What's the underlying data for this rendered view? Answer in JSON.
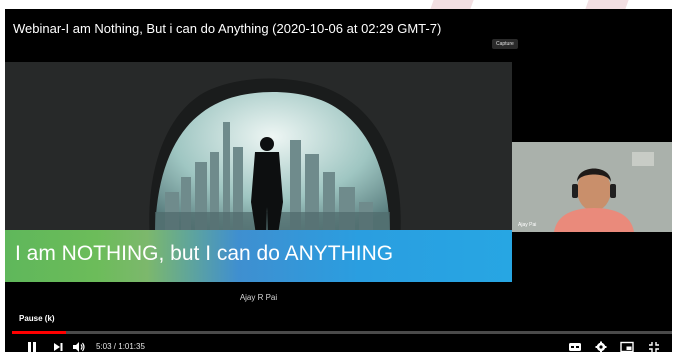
{
  "video": {
    "title": "Webinar-I am Nothing, But i can do Anything (2020-10-06 at 02:29 GMT-7)",
    "capture_label": "Capture",
    "slide_banner": "I am NOTHING, but I can do ANYTHING",
    "presenter_name": "Ajay R Pai",
    "participant_name": "Ajay Pai"
  },
  "controls": {
    "tooltip": "Pause (k)",
    "time_current": "5:03",
    "time_total": "1:01:35",
    "time_display": "5:03 / 1:01:35",
    "progress_fraction": 0.082
  },
  "icons": {
    "play_pause": "pause-icon",
    "next": "next-icon",
    "volume": "volume-icon",
    "captions": "closed-captions-icon",
    "settings": "gear-icon",
    "miniplayer": "miniplayer-icon",
    "fullscreen": "fullscreen-exit-icon"
  },
  "colors": {
    "progress": "#ff0000",
    "banner_green": "#5fb75b",
    "banner_blue": "#27a6e3",
    "background_accent": "#f2dfe2"
  }
}
